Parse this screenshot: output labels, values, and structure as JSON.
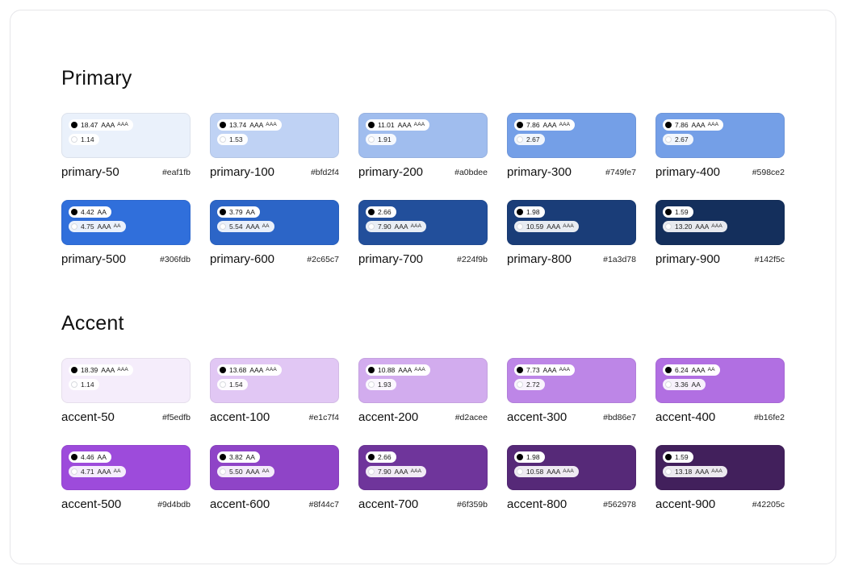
{
  "sections": [
    {
      "title": "Primary",
      "swatches": [
        {
          "name": "primary-50",
          "hex": "#eaf1fb",
          "color": "#eaf1fb",
          "black": {
            "ratio": "18.47",
            "badge": "AAA",
            "badge_small": "AAA"
          },
          "white": {
            "ratio": "1.14",
            "badge": "",
            "badge_small": ""
          }
        },
        {
          "name": "primary-100",
          "hex": "#bfd2f4",
          "color": "#bfd2f4",
          "black": {
            "ratio": "13.74",
            "badge": "AAA",
            "badge_small": "AAA"
          },
          "white": {
            "ratio": "1.53",
            "badge": "",
            "badge_small": ""
          }
        },
        {
          "name": "primary-200",
          "hex": "#a0bdee",
          "color": "#a0bdee",
          "black": {
            "ratio": "11.01",
            "badge": "AAA",
            "badge_small": "AAA"
          },
          "white": {
            "ratio": "1.91",
            "badge": "",
            "badge_small": ""
          }
        },
        {
          "name": "primary-300",
          "hex": "#749fe7",
          "color": "#749fe7",
          "black": {
            "ratio": "7.86",
            "badge": "AAA",
            "badge_small": "AAA"
          },
          "white": {
            "ratio": "2.67",
            "badge": "",
            "badge_small": ""
          }
        },
        {
          "name": "primary-400",
          "hex": "#598ce2",
          "color": "#749fe7",
          "black": {
            "ratio": "7.86",
            "badge": "AAA",
            "badge_small": "AAA"
          },
          "white": {
            "ratio": "2.67",
            "badge": "",
            "badge_small": ""
          }
        },
        {
          "name": "primary-500",
          "hex": "#306fdb",
          "color": "#306fdb",
          "black": {
            "ratio": "4.42",
            "badge": "AA",
            "badge_small": ""
          },
          "white": {
            "ratio": "4.75",
            "badge": "AAA",
            "badge_small": "AA"
          }
        },
        {
          "name": "primary-600",
          "hex": "#2c65c7",
          "color": "#2c65c7",
          "black": {
            "ratio": "3.79",
            "badge": "AA",
            "badge_small": ""
          },
          "white": {
            "ratio": "5.54",
            "badge": "AAA",
            "badge_small": "AA"
          }
        },
        {
          "name": "primary-700",
          "hex": "#224f9b",
          "color": "#224f9b",
          "black": {
            "ratio": "2.66",
            "badge": "",
            "badge_small": ""
          },
          "white": {
            "ratio": "7.90",
            "badge": "AAA",
            "badge_small": "AAA"
          }
        },
        {
          "name": "primary-800",
          "hex": "#1a3d78",
          "color": "#1a3d78",
          "black": {
            "ratio": "1.98",
            "badge": "",
            "badge_small": ""
          },
          "white": {
            "ratio": "10.59",
            "badge": "AAA",
            "badge_small": "AAA"
          }
        },
        {
          "name": "primary-900",
          "hex": "#142f5c",
          "color": "#142f5c",
          "black": {
            "ratio": "1.59",
            "badge": "",
            "badge_small": ""
          },
          "white": {
            "ratio": "13.20",
            "badge": "AAA",
            "badge_small": "AAA"
          }
        }
      ]
    },
    {
      "title": "Accent",
      "swatches": [
        {
          "name": "accent-50",
          "hex": "#f5edfb",
          "color": "#f5edfb",
          "black": {
            "ratio": "18.39",
            "badge": "AAA",
            "badge_small": "AAA"
          },
          "white": {
            "ratio": "1.14",
            "badge": "",
            "badge_small": ""
          }
        },
        {
          "name": "accent-100",
          "hex": "#e1c7f4",
          "color": "#e1c7f4",
          "black": {
            "ratio": "13.68",
            "badge": "AAA",
            "badge_small": "AAA"
          },
          "white": {
            "ratio": "1.54",
            "badge": "",
            "badge_small": ""
          }
        },
        {
          "name": "accent-200",
          "hex": "#d2acee",
          "color": "#d2acee",
          "black": {
            "ratio": "10.88",
            "badge": "AAA",
            "badge_small": "AAA"
          },
          "white": {
            "ratio": "1.93",
            "badge": "",
            "badge_small": ""
          }
        },
        {
          "name": "accent-300",
          "hex": "#bd86e7",
          "color": "#bd86e7",
          "black": {
            "ratio": "7.73",
            "badge": "AAA",
            "badge_small": "AAA"
          },
          "white": {
            "ratio": "2.72",
            "badge": "",
            "badge_small": ""
          }
        },
        {
          "name": "accent-400",
          "hex": "#b16fe2",
          "color": "#b16fe2",
          "black": {
            "ratio": "6.24",
            "badge": "AAA",
            "badge_small": "AA"
          },
          "white": {
            "ratio": "3.36",
            "badge": "AA",
            "badge_small": ""
          }
        },
        {
          "name": "accent-500",
          "hex": "#9d4bdb",
          "color": "#9d4bdb",
          "black": {
            "ratio": "4.46",
            "badge": "AA",
            "badge_small": ""
          },
          "white": {
            "ratio": "4.71",
            "badge": "AAA",
            "badge_small": "AA"
          }
        },
        {
          "name": "accent-600",
          "hex": "#8f44c7",
          "color": "#8f44c7",
          "black": {
            "ratio": "3.82",
            "badge": "AA",
            "badge_small": ""
          },
          "white": {
            "ratio": "5.50",
            "badge": "AAA",
            "badge_small": "AA"
          }
        },
        {
          "name": "accent-700",
          "hex": "#6f359b",
          "color": "#6f359b",
          "black": {
            "ratio": "2.66",
            "badge": "",
            "badge_small": ""
          },
          "white": {
            "ratio": "7.90",
            "badge": "AAA",
            "badge_small": "AAA"
          }
        },
        {
          "name": "accent-800",
          "hex": "#562978",
          "color": "#562978",
          "black": {
            "ratio": "1.98",
            "badge": "",
            "badge_small": ""
          },
          "white": {
            "ratio": "10.58",
            "badge": "AAA",
            "badge_small": "AAA"
          }
        },
        {
          "name": "accent-900",
          "hex": "#42205c",
          "color": "#42205c",
          "black": {
            "ratio": "1.59",
            "badge": "",
            "badge_small": ""
          },
          "white": {
            "ratio": "13.18",
            "badge": "AAA",
            "badge_small": "AAA"
          }
        }
      ]
    }
  ]
}
